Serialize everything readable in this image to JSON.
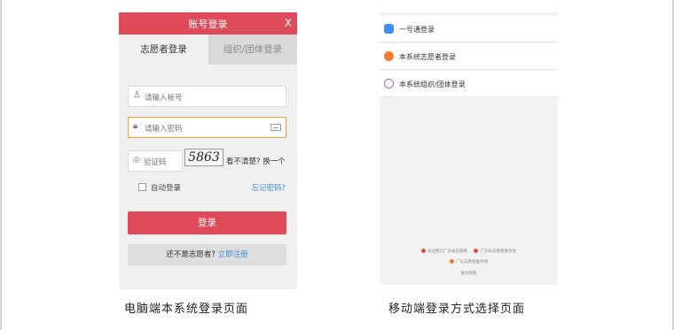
{
  "desktop": {
    "title": "账号登录",
    "close": "X",
    "tabs": [
      "志愿者登录",
      "组织/团体登录"
    ],
    "account_placeholder": "请输入帐号",
    "password_placeholder": "请输入密码",
    "captcha_placeholder": "验证码",
    "captcha_code": "5863",
    "captcha_refresh": "看不清楚? 换一个",
    "remember_label": "自动登录",
    "forgot_label": "忘记密码?",
    "login_button": "登录",
    "register_prompt": "还不是志愿者?",
    "register_link": "立即注册"
  },
  "mobile": {
    "options": [
      {
        "label": "一号通登录",
        "icon": "phone-icon",
        "color": "#3d8ef5"
      },
      {
        "label": "本系统志愿者登录",
        "icon": "volunteer-icon",
        "color": "#f07c2c"
      },
      {
        "label": "本系统组织/团体登录",
        "icon": "group-icon",
        "color": "#9b6ad3"
      }
    ],
    "footer": [
      "关注我们",
      "广东省志愿者",
      "广东省志愿者联合会",
      "广东志愿者服务网",
      "服务邮箱"
    ]
  },
  "captions": {
    "left": "电脑端本系统登录页面",
    "right": "移动端登录方式选择页面"
  },
  "colors": {
    "brand_red": "#de4a57",
    "link_blue": "#3a8fd6",
    "focus_orange": "#f0a33a"
  }
}
